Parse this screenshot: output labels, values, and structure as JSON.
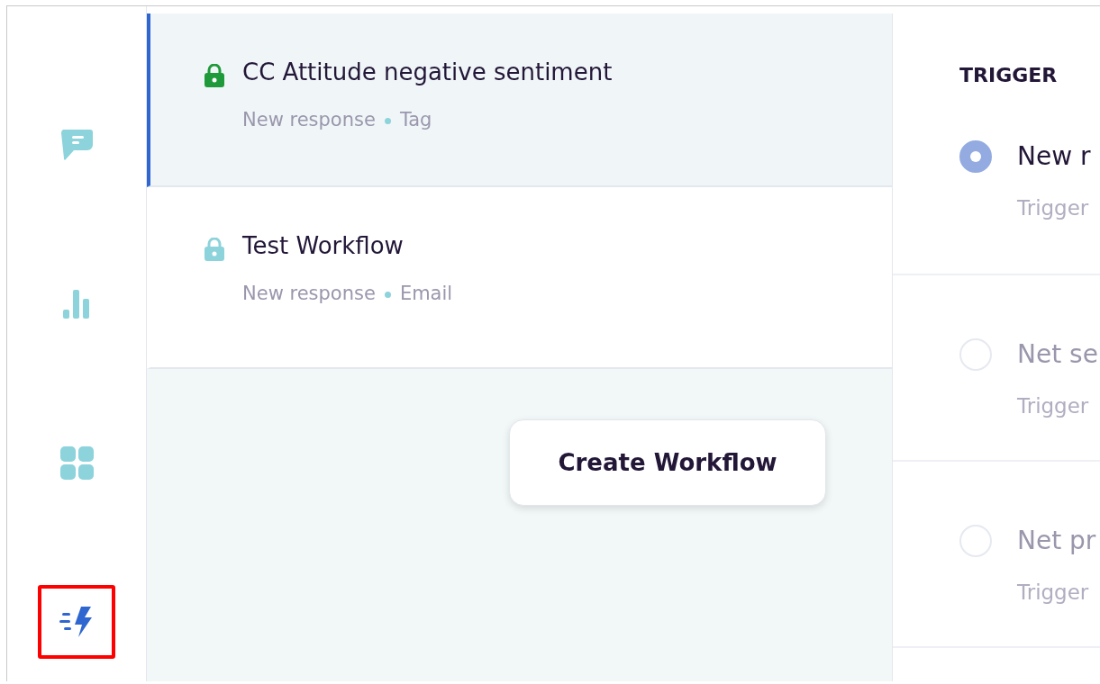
{
  "nav": [
    {
      "kind": "chat",
      "selected": false,
      "highlighted": false
    },
    {
      "kind": "chart",
      "selected": false,
      "highlighted": false
    },
    {
      "kind": "grid",
      "selected": false,
      "highlighted": false
    },
    {
      "kind": "bolt",
      "selected": true,
      "highlighted": true
    }
  ],
  "workflows": [
    {
      "title": "CC Attitude negative sentiment",
      "trigger": "New response",
      "action": "Tag",
      "color": "#1f9a3a",
      "selected": true
    },
    {
      "title": "Test Workflow",
      "trigger": "New response",
      "action": "Email",
      "color": "#8dd3db",
      "selected": false
    }
  ],
  "create_button": "Create Workflow",
  "trigger_panel": {
    "heading": "TRIGGER",
    "options": [
      {
        "label": "New r",
        "description": "Trigger",
        "selected": true
      },
      {
        "label": "Net se",
        "description": "Trigger",
        "selected": false
      },
      {
        "label": "Net pr",
        "description": "Trigger",
        "selected": false
      }
    ]
  }
}
